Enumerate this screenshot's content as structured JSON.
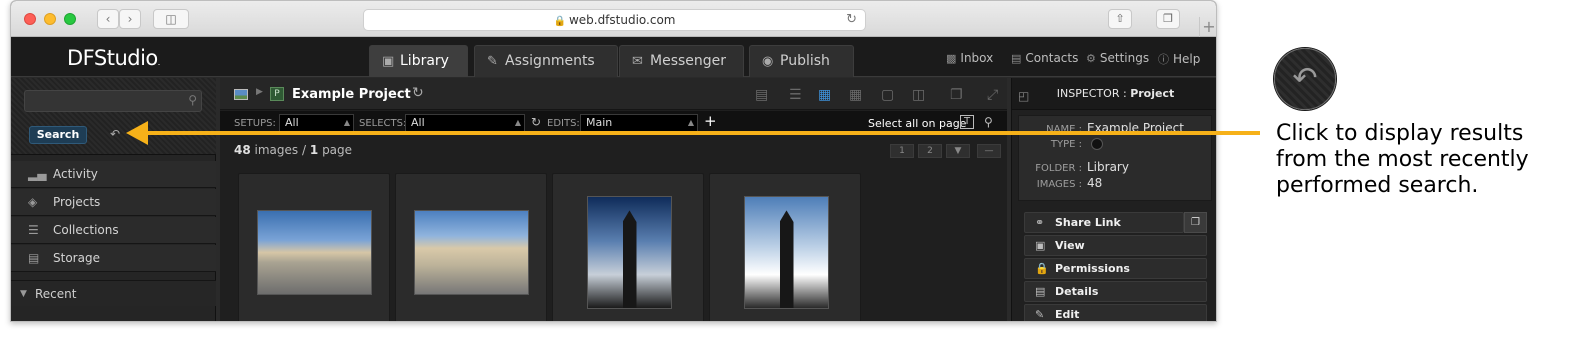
{
  "browser": {
    "url": "web.dfstudio.com"
  },
  "app": {
    "logo": "DFStudio",
    "logo_mark": ".",
    "tabs": [
      {
        "label": "Library",
        "icon": "image-icon"
      },
      {
        "label": "Assignments",
        "icon": "pencil-icon"
      },
      {
        "label": "Messenger",
        "icon": "envelope-icon"
      },
      {
        "label": "Publish",
        "icon": "globe-icon"
      }
    ],
    "top_links": [
      {
        "label": "Inbox",
        "icon": "inbox-icon"
      },
      {
        "label": "Contacts",
        "icon": "contacts-icon"
      },
      {
        "label": "Settings",
        "icon": "gear-icon"
      },
      {
        "label": "Help",
        "icon": "help-icon"
      }
    ]
  },
  "left": {
    "search_button": "Search",
    "nav": [
      {
        "label": "Activity",
        "icon": "bar-chart-icon"
      },
      {
        "label": "Projects",
        "icon": "layers-icon"
      },
      {
        "label": "Collections",
        "icon": "stack-icon"
      },
      {
        "label": "Storage",
        "icon": "storage-icon"
      }
    ],
    "recent": "Recent"
  },
  "center": {
    "project_title": "Example Project",
    "project_badge": "P",
    "filters": {
      "setups_label": "SETUPS:",
      "setups_value": "All",
      "selects_label": "SELECTS:",
      "selects_value": "All",
      "edits_label": "EDITS:",
      "edits_value": "Main",
      "add_label": "+",
      "select_all": "Select all on page",
      "text_toggle": "T"
    },
    "count": {
      "images": "48",
      "images_label": "images",
      "separator": "/",
      "pages": "1",
      "pages_label": "page"
    },
    "pages": [
      "1",
      "2"
    ]
  },
  "inspector": {
    "title_prefix": "INSPECTOR :",
    "title": "Project",
    "name_label": "NAME :",
    "name_value": "Example Project",
    "type_label": "TYPE :",
    "folder_label": "FOLDER :",
    "folder_value": "Library",
    "images_label": "IMAGES :",
    "images_value": "48",
    "actions": [
      {
        "label": "Share Link",
        "icon": "link-icon"
      },
      {
        "label": "View",
        "icon": "view-icon"
      },
      {
        "label": "Permissions",
        "icon": "lock-icon"
      },
      {
        "label": "Details",
        "icon": "details-icon"
      },
      {
        "label": "Edit",
        "icon": "pencil-icon"
      }
    ]
  },
  "annotation": {
    "text": "Click to display results from the most recently performed search.",
    "color": "#f6b119"
  }
}
